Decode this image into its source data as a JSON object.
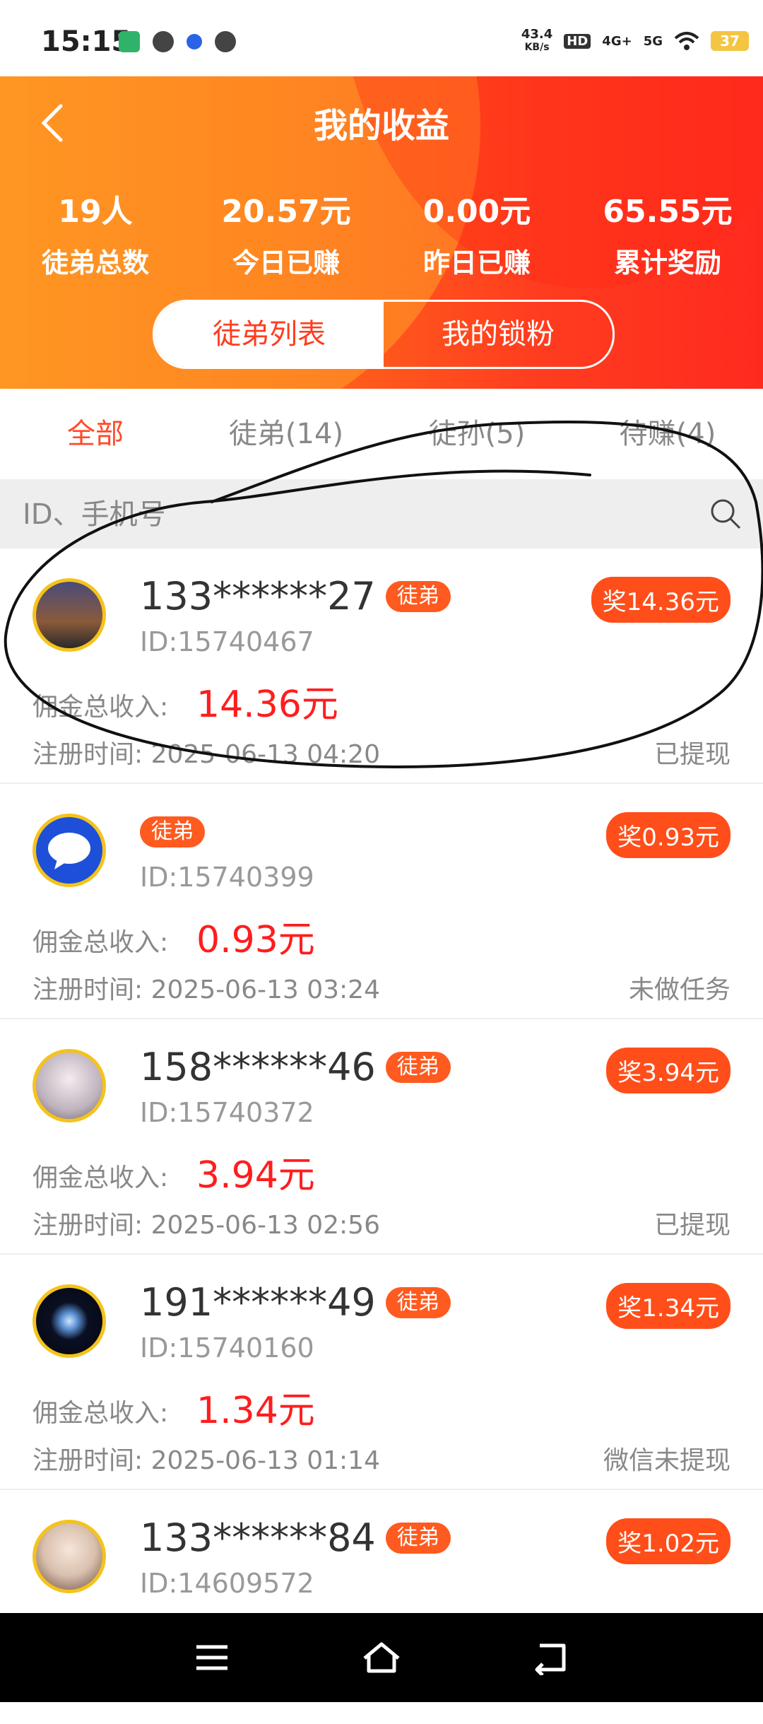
{
  "status_bar": {
    "time": "15:15",
    "net_speed_top": "43.4",
    "net_speed_bottom": "KB/s",
    "hd": "HD",
    "net1": "4G+",
    "net2": "5G",
    "battery": "37"
  },
  "header": {
    "title": "我的收益",
    "stats": [
      {
        "value": "19人",
        "label": "徒弟总数"
      },
      {
        "value": "20.57元",
        "label": "今日已赚"
      },
      {
        "value": "0.00元",
        "label": "昨日已赚"
      },
      {
        "value": "65.55元",
        "label": "累计奖励"
      }
    ],
    "segments": [
      "徒弟列表",
      "我的锁粉"
    ]
  },
  "tabs": [
    "全部",
    "徒弟(14)",
    "徒孙(5)",
    "待赚(4)"
  ],
  "search": {
    "placeholder": "ID、手机号"
  },
  "list": [
    {
      "phone": "133******27",
      "tag": "徒弟",
      "id": "ID:15740467",
      "award": "奖14.36元",
      "income_label": "佣金总收入:",
      "income": "14.36元",
      "reg": "注册时间: 2025-06-13 04:20",
      "status": "已提现",
      "avatar_color": "#3a3a5a"
    },
    {
      "phone": "",
      "tag": "徒弟",
      "id": "ID:15740399",
      "award": "奖0.93元",
      "income_label": "佣金总收入:",
      "income": "0.93元",
      "reg": "注册时间: 2025-06-13 03:24",
      "status": "未做任务",
      "avatar_color": "#1e4fd8"
    },
    {
      "phone": "158******46",
      "tag": "徒弟",
      "id": "ID:15740372",
      "award": "奖3.94元",
      "income_label": "佣金总收入:",
      "income": "3.94元",
      "reg": "注册时间: 2025-06-13 02:56",
      "status": "已提现",
      "avatar_color": "#d9cfd6"
    },
    {
      "phone": "191******49",
      "tag": "徒弟",
      "id": "ID:15740160",
      "award": "奖1.34元",
      "income_label": "佣金总收入:",
      "income": "1.34元",
      "reg": "注册时间: 2025-06-13 01:14",
      "status": "微信未提现",
      "avatar_color": "#05070f"
    },
    {
      "phone": "133******84",
      "tag": "徒弟",
      "id": "ID:14609572",
      "award": "奖1.02元",
      "income_label": "",
      "income": "",
      "reg": "",
      "status": "",
      "avatar_color": "#e8d8cc"
    }
  ]
}
